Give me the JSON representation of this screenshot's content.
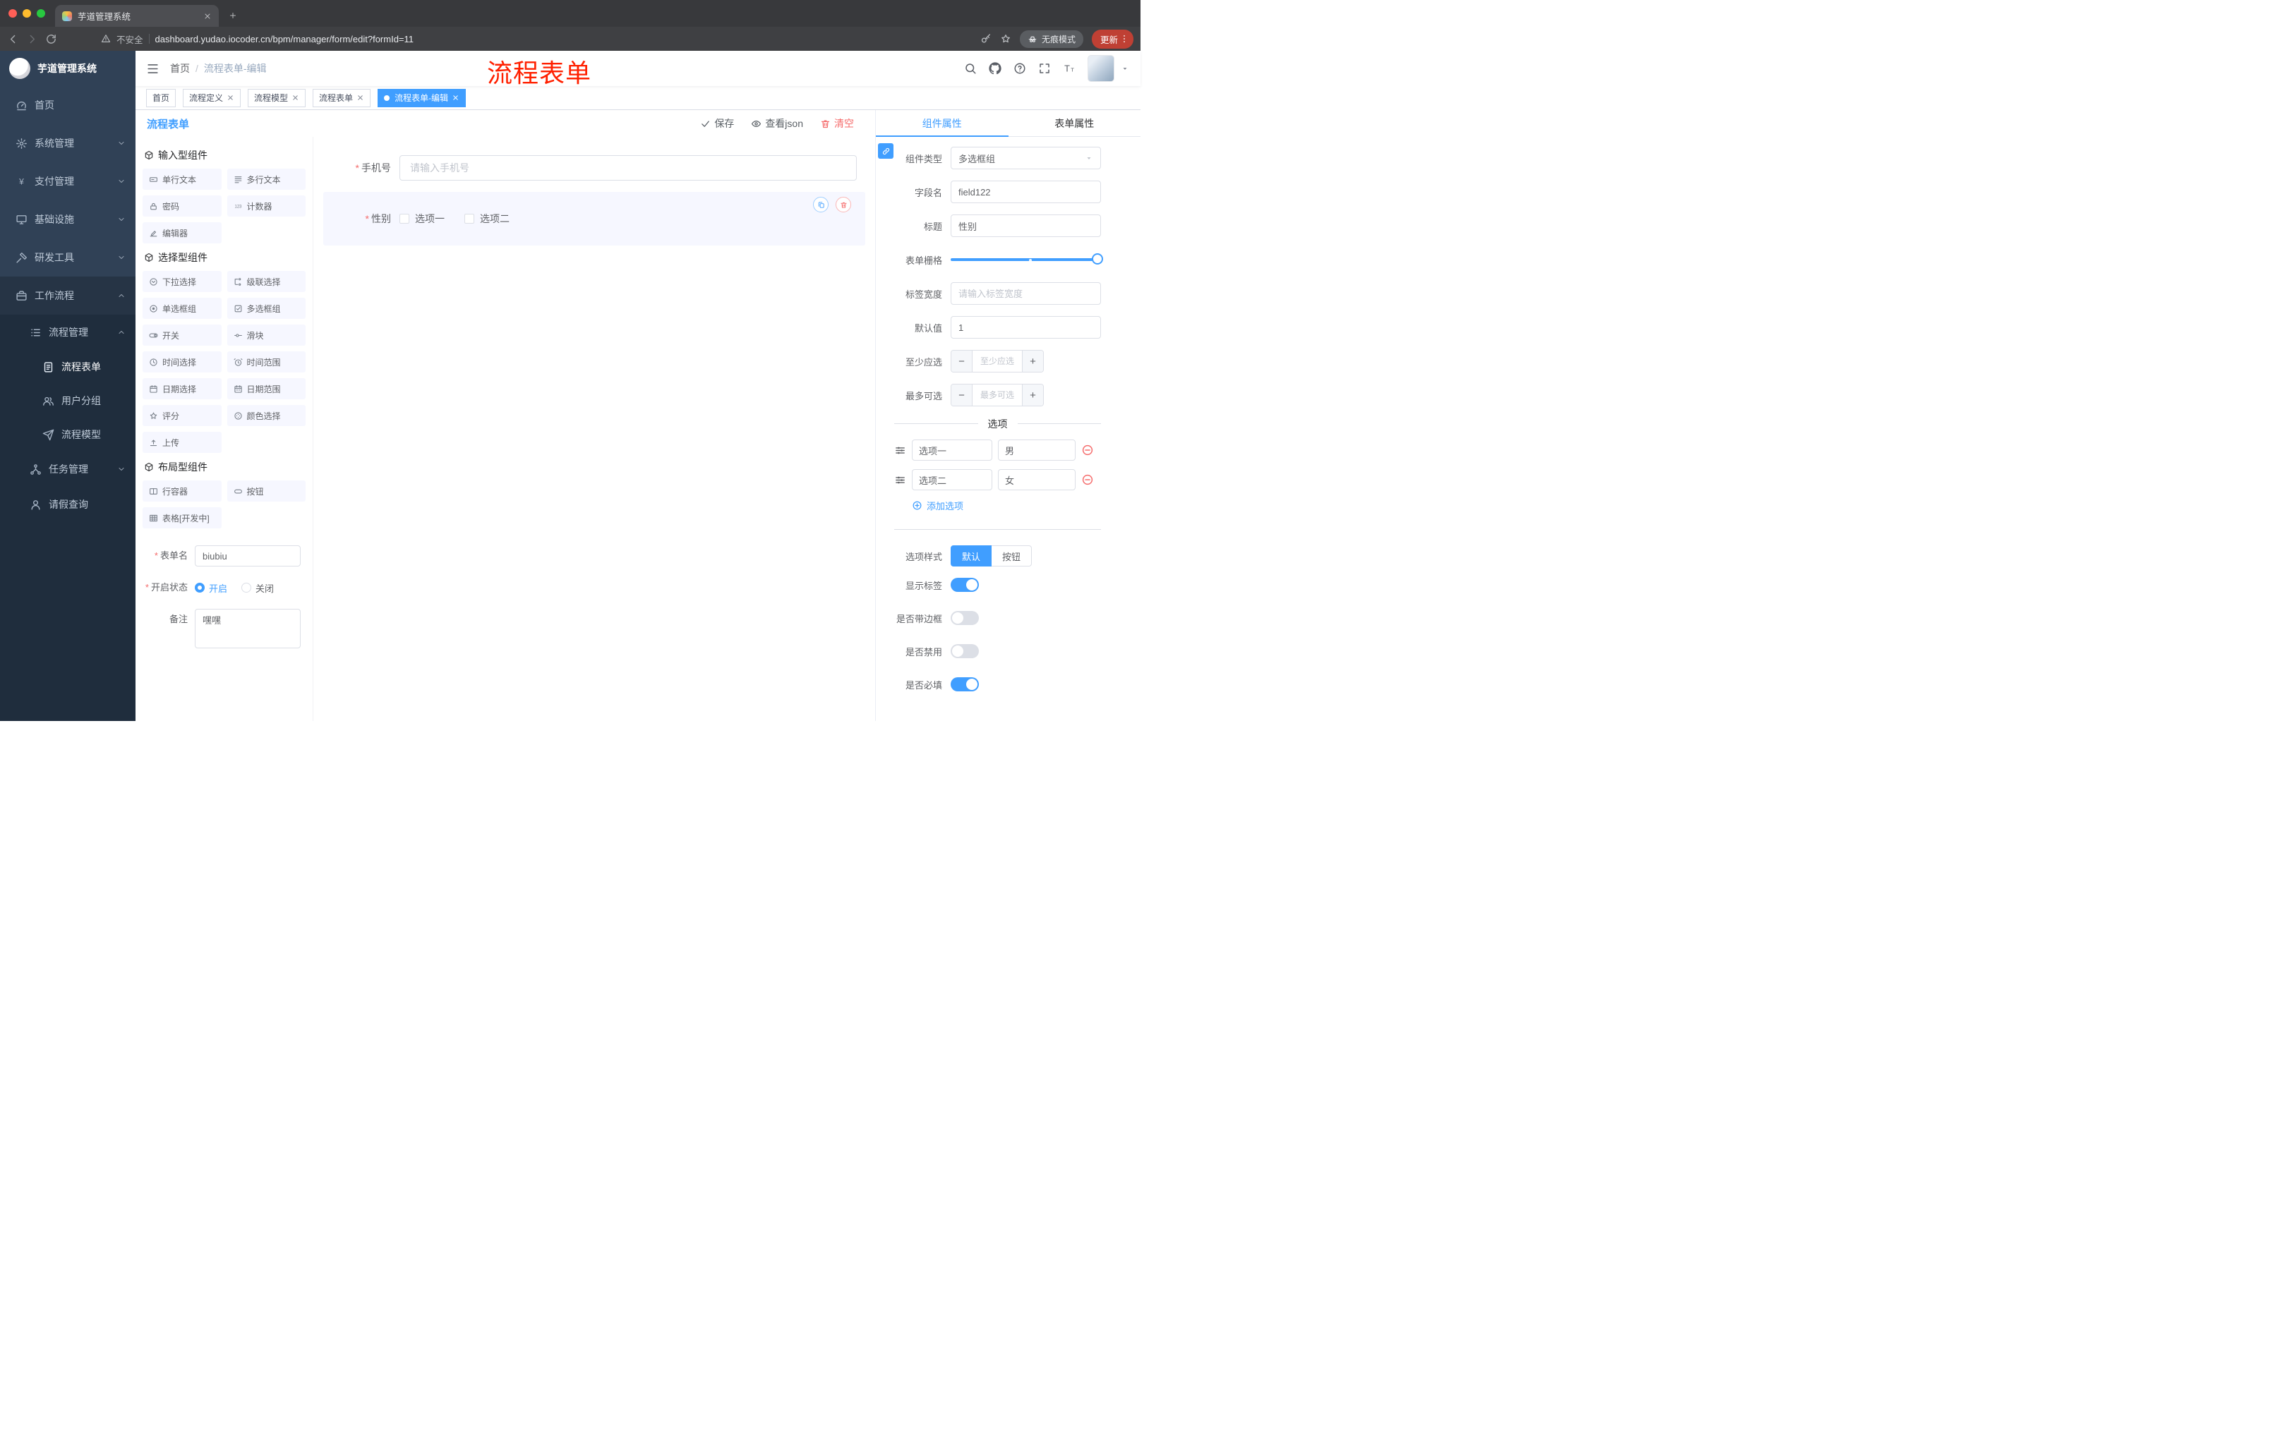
{
  "annotation": {
    "text": "流程表单"
  },
  "colors": {
    "accent": "#409eff",
    "danger": "#f56c6c",
    "annotation": "#ff2000"
  },
  "browser": {
    "tab_title": "芋道管理系统",
    "security_label": "不安全",
    "url": "dashboard.yudao.iocoder.cn/bpm/manager/form/edit?formId=11",
    "incognito_label": "无痕模式",
    "update_label": "更新"
  },
  "sidebar": {
    "logo_title": "芋道管理系统",
    "menu": [
      {
        "label": "首页",
        "icon": "home-icon"
      },
      {
        "label": "系统管理",
        "icon": "gear-icon"
      },
      {
        "label": "支付管理",
        "icon": "yen-icon"
      },
      {
        "label": "基础设施",
        "icon": "monitor-icon"
      },
      {
        "label": "研发工具",
        "icon": "tool-icon"
      },
      {
        "label": "工作流程",
        "icon": "briefcase-icon"
      },
      {
        "label": "流程管理",
        "icon": "list-icon"
      },
      {
        "label": "流程表单",
        "icon": "doc-icon"
      },
      {
        "label": "用户分组",
        "icon": "users-icon"
      },
      {
        "label": "流程模型",
        "icon": "send-icon"
      },
      {
        "label": "任务管理",
        "icon": "tree-icon"
      },
      {
        "label": "请假查询",
        "icon": "person-icon"
      }
    ]
  },
  "header": {
    "breadcrumb": {
      "home": "首页",
      "separator": "/",
      "current": "流程表单-编辑"
    }
  },
  "tags": [
    {
      "label": "首页"
    },
    {
      "label": "流程定义"
    },
    {
      "label": "流程模型"
    },
    {
      "label": "流程表单"
    },
    {
      "label": "流程表单-编辑"
    }
  ],
  "toolbar": {
    "title": "流程表单",
    "save_label": "保存",
    "view_json_label": "查看json",
    "clear_label": "清空"
  },
  "library": {
    "sections": [
      {
        "title": "输入型组件",
        "items": [
          {
            "label": "单行文本",
            "icon": "input-text-icon"
          },
          {
            "label": "多行文本",
            "icon": "textarea-icon"
          },
          {
            "label": "密码",
            "icon": "lock-icon"
          },
          {
            "label": "计数器",
            "icon": "counter-icon"
          },
          {
            "label": "编辑器",
            "icon": "editor-icon"
          }
        ]
      },
      {
        "title": "选择型组件",
        "items": [
          {
            "label": "下拉选择",
            "icon": "select-icon"
          },
          {
            "label": "级联选择",
            "icon": "cascader-icon"
          },
          {
            "label": "单选框组",
            "icon": "radio-icon"
          },
          {
            "label": "多选框组",
            "icon": "checkbox-icon"
          },
          {
            "label": "开关",
            "icon": "switch-icon"
          },
          {
            "label": "滑块",
            "icon": "slider-icon"
          },
          {
            "label": "时间选择",
            "icon": "time-icon"
          },
          {
            "label": "时间范围",
            "icon": "time-range-icon"
          },
          {
            "label": "日期选择",
            "icon": "date-icon"
          },
          {
            "label": "日期范围",
            "icon": "date-range-icon"
          },
          {
            "label": "评分",
            "icon": "rate-icon"
          },
          {
            "label": "颜色选择",
            "icon": "color-icon"
          },
          {
            "label": "上传",
            "icon": "upload-icon"
          }
        ]
      },
      {
        "title": "布局型组件",
        "items": [
          {
            "label": "行容器",
            "icon": "row-icon"
          },
          {
            "label": "按钮",
            "icon": "button-icon"
          },
          {
            "label": "表格[开发中]",
            "icon": "table-icon"
          }
        ]
      }
    ],
    "meta": {
      "name_label": "表单名",
      "name_value": "biubiu",
      "status_label": "开启状态",
      "status_on": "开启",
      "status_off": "关闭",
      "remark_label": "备注",
      "remark_value": "嘿嘿"
    }
  },
  "canvas": {
    "phone": {
      "label": "手机号",
      "placeholder": "请输入手机号"
    },
    "gender": {
      "label": "性别",
      "option1": "选项一",
      "option2": "选项二"
    }
  },
  "props": {
    "tab_component": "组件属性",
    "tab_form": "表单属性",
    "rows": {
      "type_label": "组件类型",
      "type_value": "多选框组",
      "field_label": "字段名",
      "field_value": "field122",
      "title_label": "标题",
      "title_value": "性别",
      "grid_label": "表单栅格",
      "width_label": "标签宽度",
      "width_placeholder": "请输入标签宽度",
      "default_label": "默认值",
      "default_value": "1",
      "min_label": "至少应选",
      "min_placeholder": "至少应选",
      "max_label": "最多可选",
      "max_placeholder": "最多可选"
    },
    "options_title": "选项",
    "options": [
      {
        "name": "选项一",
        "value": "男"
      },
      {
        "name": "选项二",
        "value": "女"
      }
    ],
    "add_option": "添加选项",
    "style_label": "选项样式",
    "style_default": "默认",
    "style_button": "按钮",
    "switches": [
      {
        "label": "显示标签",
        "on": true
      },
      {
        "label": "是否带边框",
        "on": false
      },
      {
        "label": "是否禁用",
        "on": false
      },
      {
        "label": "是否必填",
        "on": true
      }
    ]
  }
}
